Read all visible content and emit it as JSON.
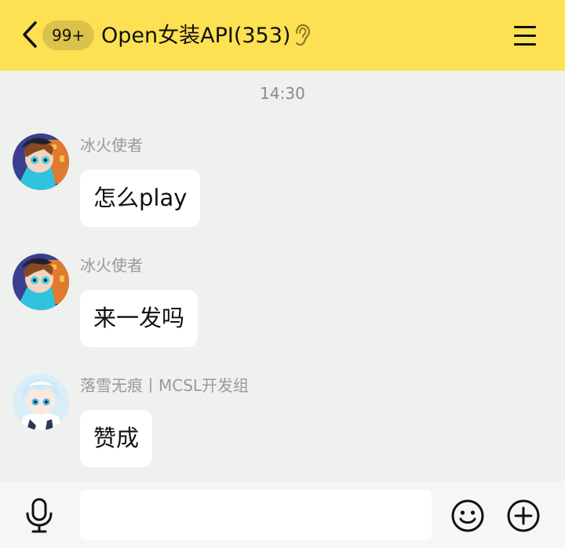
{
  "header": {
    "unread_badge": "99+",
    "title": "Open女装API(353)",
    "back_icon": "chevron-left-icon",
    "ear_icon": "ear-icon",
    "menu_icon": "hamburger-menu-icon",
    "background": "#fee153"
  },
  "chat": {
    "timestamp": "14:30",
    "messages": [
      {
        "sender": "冰火使者",
        "text": "怎么play",
        "avatar": "avatar-anime-boy"
      },
      {
        "sender": "冰火使者",
        "text": "来一发吗",
        "avatar": "avatar-anime-boy"
      },
      {
        "sender": "落雪无痕丨MCSL开发组",
        "text": "赞成",
        "avatar": "avatar-anime-white-hair"
      }
    ]
  },
  "input_bar": {
    "value": "",
    "mic_icon": "microphone-icon",
    "emoji_icon": "smiley-icon",
    "plus_icon": "plus-circle-icon"
  }
}
